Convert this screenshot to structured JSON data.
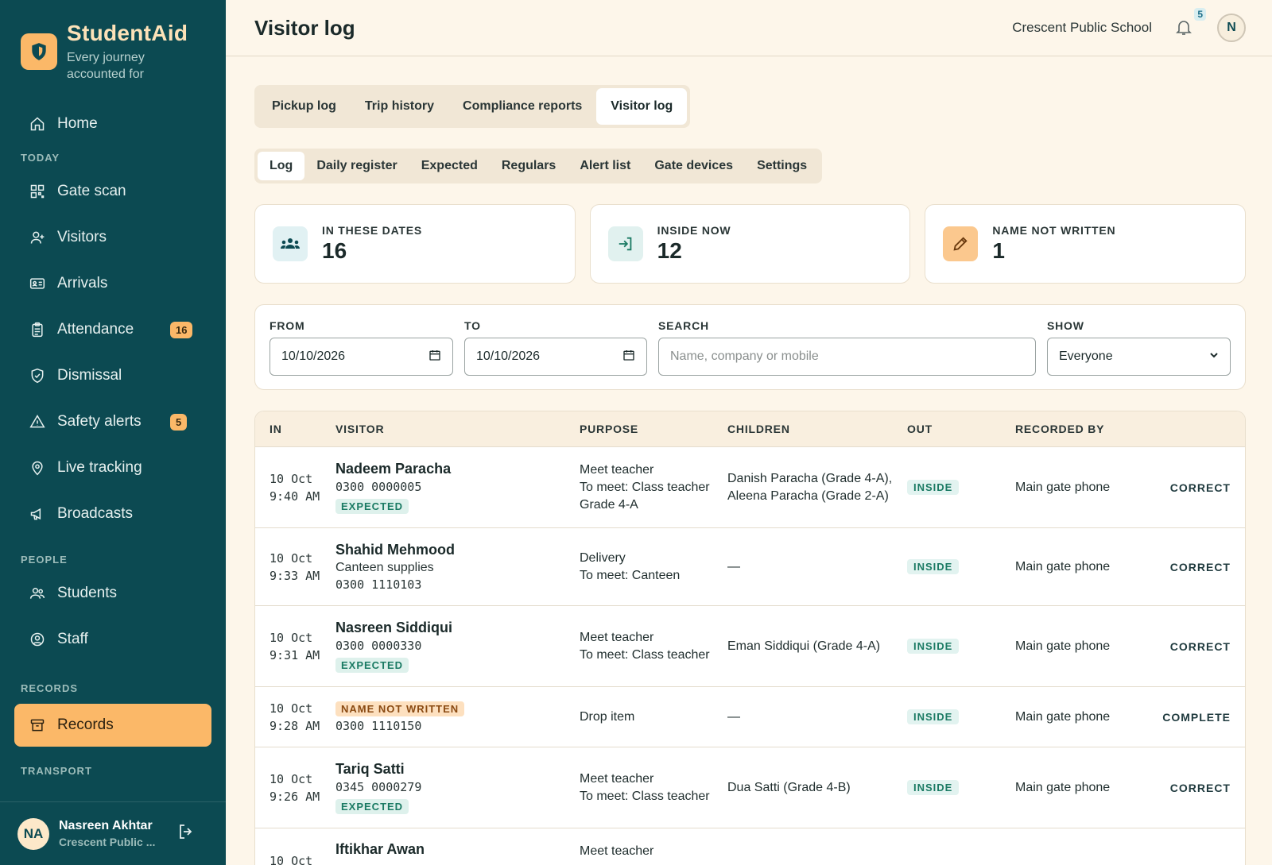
{
  "brand": {
    "name": "StudentAid",
    "tagline": "Every journey accounted for"
  },
  "sidebar": {
    "home": "Home",
    "sections": {
      "today": "TODAY",
      "people": "PEOPLE",
      "records": "RECORDS",
      "transport": "TRANSPORT"
    },
    "items": [
      {
        "label": "Gate scan",
        "icon": "qr-icon"
      },
      {
        "label": "Visitors",
        "icon": "user-plus-icon"
      },
      {
        "label": "Arrivals",
        "icon": "id-card-icon"
      },
      {
        "label": "Attendance",
        "icon": "clipboard-icon",
        "badge": "16"
      },
      {
        "label": "Dismissal",
        "icon": "shield-check-icon"
      },
      {
        "label": "Safety alerts",
        "icon": "warning-icon",
        "badge": "5"
      },
      {
        "label": "Live tracking",
        "icon": "location-pin-icon"
      },
      {
        "label": "Broadcasts",
        "icon": "megaphone-icon"
      },
      {
        "label": "Students",
        "icon": "students-icon"
      },
      {
        "label": "Staff",
        "icon": "staff-icon"
      },
      {
        "label": "Records",
        "icon": "archive-icon",
        "active": true
      }
    ],
    "user": {
      "initials": "NA",
      "name": "Nasreen Akhtar",
      "org": "Crescent Public ..."
    }
  },
  "header": {
    "title": "Visitor log",
    "school": "Crescent Public School",
    "notifications": "5",
    "avatar": "N"
  },
  "tabs_primary": [
    "Pickup log",
    "Trip history",
    "Compliance reports",
    "Visitor log"
  ],
  "tabs_primary_active": "Visitor log",
  "tabs_secondary": [
    "Log",
    "Daily register",
    "Expected",
    "Regulars",
    "Alert list",
    "Gate devices",
    "Settings"
  ],
  "tabs_secondary_active": "Log",
  "stats": [
    {
      "label": "IN THESE DATES",
      "value": "16",
      "icon": "group-icon"
    },
    {
      "label": "INSIDE NOW",
      "value": "12",
      "icon": "sign-in-icon"
    },
    {
      "label": "NAME NOT WRITTEN",
      "value": "1",
      "icon": "pencil-icon"
    }
  ],
  "filters": {
    "from_label": "FROM",
    "from_value": "10/10/2026",
    "to_label": "TO",
    "to_value": "10/10/2026",
    "search_label": "SEARCH",
    "search_placeholder": "Name, company or mobile",
    "show_label": "SHOW",
    "show_value": "Everyone"
  },
  "table": {
    "headers": [
      "IN",
      "VISITOR",
      "PURPOSE",
      "CHILDREN",
      "OUT",
      "RECORDED BY"
    ],
    "rows": [
      {
        "date": "10 Oct",
        "time": "9:40 AM",
        "name": "Nadeem Paracha",
        "company": "",
        "phone": "0300 0000005",
        "tag": "EXPECTED",
        "purpose": "Meet teacher",
        "meet": "To meet: Class teacher Grade 4-A",
        "children": "Danish Paracha (Grade 4-A), Aleena Paracha (Grade 2-A)",
        "out": "INSIDE",
        "recorded": "Main gate phone",
        "action": "CORRECT"
      },
      {
        "date": "10 Oct",
        "time": "9:33 AM",
        "name": "Shahid Mehmood",
        "company": "Canteen supplies",
        "phone": "0300 1110103",
        "tag": "",
        "purpose": "Delivery",
        "meet": "To meet: Canteen",
        "children": "—",
        "out": "INSIDE",
        "recorded": "Main gate phone",
        "action": "CORRECT"
      },
      {
        "date": "10 Oct",
        "time": "9:31 AM",
        "name": "Nasreen Siddiqui",
        "company": "",
        "phone": "0300 0000330",
        "tag": "EXPECTED",
        "purpose": "Meet teacher",
        "meet": "To meet: Class teacher",
        "children": "Eman Siddiqui (Grade 4-A)",
        "out": "INSIDE",
        "recorded": "Main gate phone",
        "action": "CORRECT"
      },
      {
        "date": "10 Oct",
        "time": "9:28 AM",
        "name": "",
        "name_tag": "NAME NOT WRITTEN",
        "company": "",
        "phone": "0300 1110150",
        "tag": "",
        "purpose": "Drop item",
        "meet": "",
        "children": "—",
        "out": "INSIDE",
        "recorded": "Main gate phone",
        "action": "COMPLETE"
      },
      {
        "date": "10 Oct",
        "time": "9:26 AM",
        "name": "Tariq Satti",
        "company": "",
        "phone": "0345 0000279",
        "tag": "EXPECTED",
        "purpose": "Meet teacher",
        "meet": "To meet: Class teacher",
        "children": "Dua Satti (Grade 4-B)",
        "out": "INSIDE",
        "recorded": "Main gate phone",
        "action": "CORRECT"
      },
      {
        "date": "10 Oct",
        "time": "",
        "name": "Iftikhar Awan",
        "company": "",
        "phone": "",
        "tag": "",
        "purpose": "Meet teacher",
        "meet": "",
        "children": "",
        "out": "",
        "recorded": "",
        "action": ""
      }
    ]
  }
}
